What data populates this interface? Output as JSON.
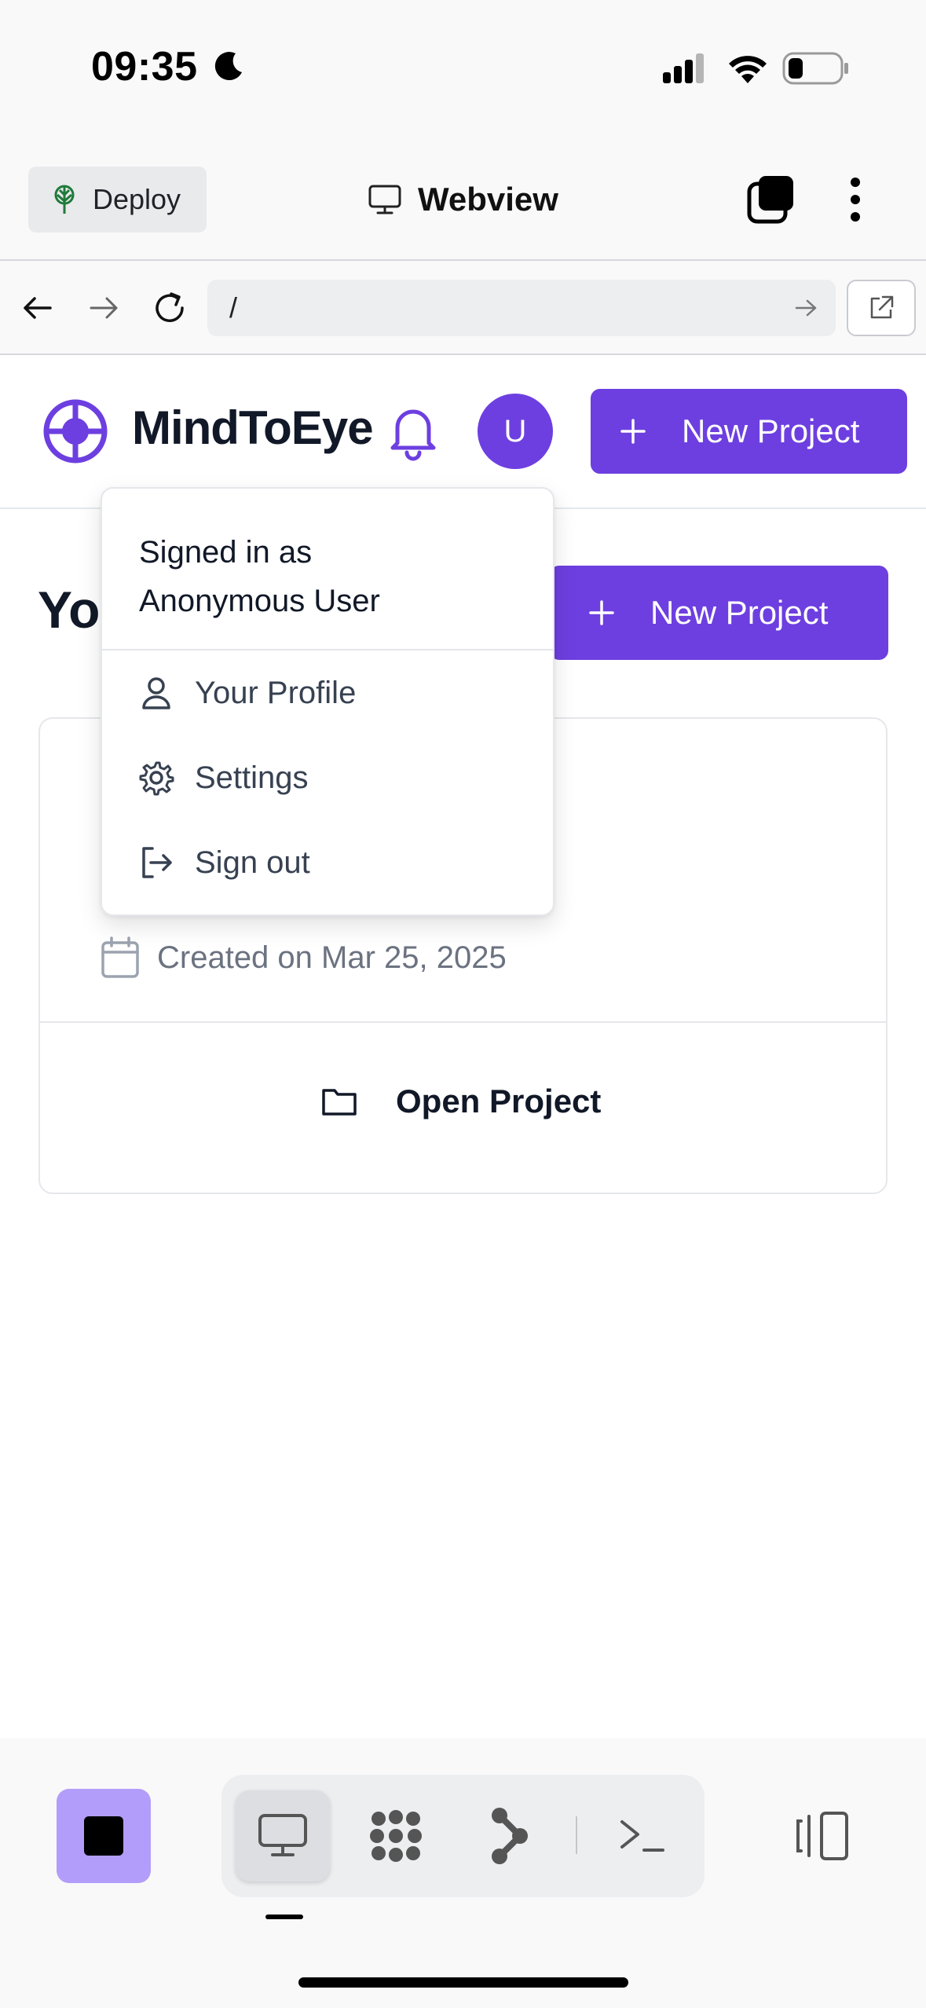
{
  "status_bar": {
    "time": "09:35"
  },
  "replit_header": {
    "deploy_label": "Deploy",
    "webview_label": "Webview"
  },
  "url_bar": {
    "value": "/"
  },
  "app_header": {
    "brand": "MindToEye",
    "avatar_letter": "U",
    "new_project_label": "New Project"
  },
  "page": {
    "title": "Yo",
    "new_project_label": "New Project",
    "project_card": {
      "created_label": "Created on Mar 25, 2025",
      "open_label": "Open Project"
    }
  },
  "user_menu": {
    "signed_in_prefix": "Signed in as",
    "user_name": "Anonymous User",
    "items": [
      {
        "label": "Your Profile",
        "icon": "user-icon"
      },
      {
        "label": "Settings",
        "icon": "gear-icon"
      },
      {
        "label": "Sign out",
        "icon": "sign-out-icon"
      }
    ]
  },
  "colors": {
    "brand": "#6d3fe0",
    "stop_button": "#b39dfa",
    "toolbar_bg": "#f9f9fa"
  }
}
